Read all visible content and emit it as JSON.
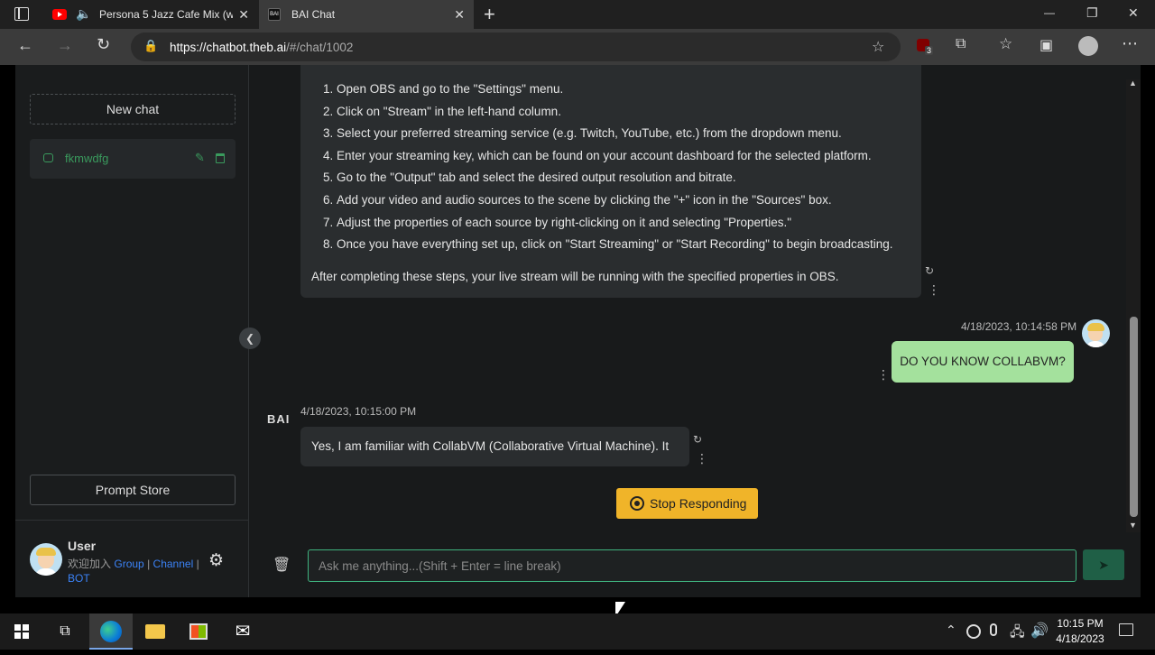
{
  "browser": {
    "tabs": [
      {
        "title": "Persona 5 Jazz Cafe Mix (w/",
        "close": "✕"
      },
      {
        "title": "BAI Chat",
        "close": "✕"
      }
    ],
    "new_tab": "+",
    "window_controls": {
      "minimize": "—",
      "restore": "❐",
      "close": "✕"
    },
    "url_main": "https://chatbot.theb.ai",
    "url_rest": "/#/chat/1002",
    "extension_badge": "3"
  },
  "sidebar": {
    "new_chat_label": "New chat",
    "chats": [
      {
        "name": "fkmwdfg"
      }
    ],
    "prompt_store_label": "Prompt Store",
    "user": {
      "name": "User",
      "join_text": "欢迎加入",
      "links": [
        "Group",
        "Channel",
        "BOT"
      ],
      "sep": "|"
    }
  },
  "chat": {
    "ai_steps": [
      "Open OBS and go to the \"Settings\" menu.",
      "Click on \"Stream\" in the left-hand column.",
      "Select your preferred streaming service (e.g. Twitch, YouTube, etc.) from the dropdown menu.",
      "Enter your streaming key, which can be found on your account dashboard for the selected platform.",
      "Go to the \"Output\" tab and select the desired output resolution and bitrate.",
      "Add your video and audio sources to the scene by clicking the \"+\" icon in the \"Sources\" box.",
      "Adjust the properties of each source by right-clicking on it and selecting \"Properties.\"",
      "Once you have everything set up, click on \"Start Streaming\" or \"Start Recording\" to begin broadcasting."
    ],
    "ai_after": "After completing these steps, your live stream will be running with the specified properties in OBS.",
    "user_timestamp": "4/18/2023, 10:14:58 PM",
    "user_message": "DO YOU KNOW COLLABVM?",
    "bot_logo": "BAI",
    "ai_timestamp": "4/18/2023, 10:15:00 PM",
    "ai_message": "Yes, I am familiar with CollabVM (Collaborative Virtual Machine). It",
    "stop_label": "Stop Responding",
    "input_placeholder": "Ask me anything...(Shift + Enter = line break)"
  },
  "taskbar": {
    "time": "10:15 PM",
    "date": "4/18/2023"
  },
  "colors": {
    "accent_green": "#3fb37f",
    "user_bubble": "#a4e19d",
    "stop_button": "#f0b429",
    "link_blue": "#3b82f6"
  }
}
